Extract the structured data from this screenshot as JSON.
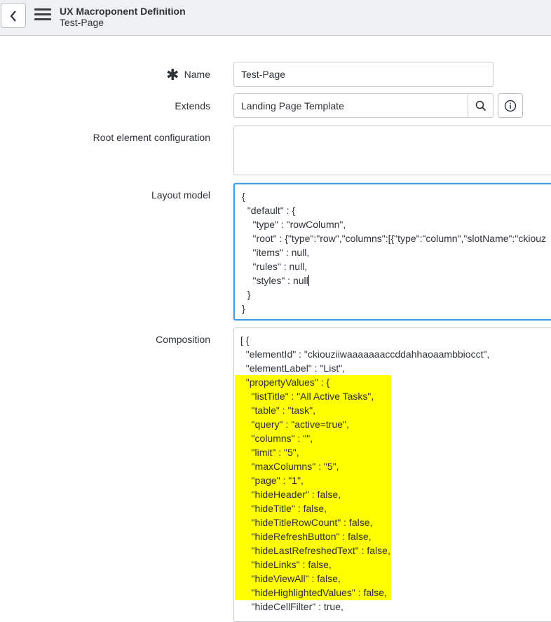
{
  "header": {
    "title": "UX Macroponent Definition",
    "subtitle": "Test-Page",
    "back_icon": "chevron-left-icon",
    "menu_icon": "hamburger-menu-icon"
  },
  "form": {
    "name": {
      "label": "Name",
      "value": "Test-Page",
      "required_mark": "✱"
    },
    "extends": {
      "label": "Extends",
      "value": "Landing Page Template"
    },
    "root_config": {
      "label": "Root element configuration",
      "value": ""
    },
    "layout_model": {
      "label": "Layout model",
      "lines": [
        "{",
        "  \"default\" : {",
        "    \"type\" : \"rowColumn\",",
        "    \"root\" : {\"type\":\"row\",\"columns\":[{\"type\":\"column\",\"slotName\":\"ckiouz",
        "    \"items\" : null,",
        "    \"rules\" : null,",
        "    \"styles\" : nul",
        "  }",
        "}"
      ],
      "last_char": "l"
    },
    "composition": {
      "label": "Composition",
      "lines": [
        "[ {",
        "  \"elementId\" : \"ckiouziiwaaaaaaaccddahhaoaambbiocct\",",
        "  \"elementLabel\" : \"List\",",
        "  \"propertyValues\" : {",
        "    \"listTitle\" : \"All Active Tasks\",",
        "    \"table\" : \"task\",",
        "    \"query\" : \"active=true\",",
        "    \"columns\" : \"\",",
        "    \"limit\" : \"5\",",
        "    \"maxColumns\" : \"5\",",
        "    \"page\" : \"1\",",
        "    \"hideHeader\" : false,",
        "    \"hideTitle\" : false,",
        "    \"hideTitleRowCount\" : false,",
        "    \"hideRefreshButton\" : false,",
        "    \"hideLastRefreshedText\" : false,",
        "    \"hideLinks\" : false,",
        "    \"hideViewAll\" : false,",
        "    \"hideHighlightedValues\" : false,",
        "    \"hideCellFilter\" : true,"
      ],
      "highlight_color": "#ffff00"
    }
  },
  "colors": {
    "focus": "#4a9ee5",
    "header_bg": "#eef0f2"
  }
}
